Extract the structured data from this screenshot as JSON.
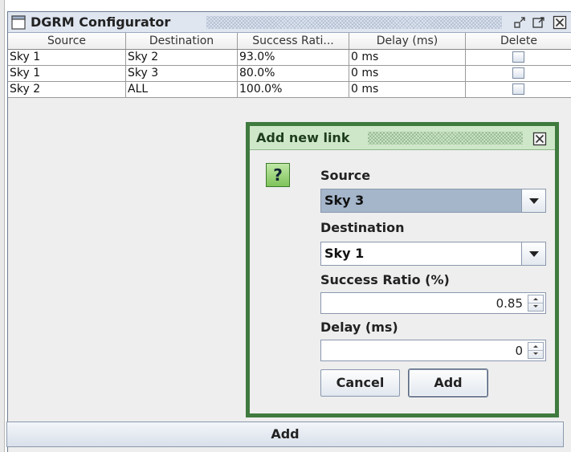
{
  "window": {
    "title": "DGRM Configurator"
  },
  "table": {
    "columns": [
      "Source",
      "Destination",
      "Success Rati...",
      "Delay (ms)",
      "Delete"
    ],
    "rows": [
      {
        "source": "Sky 1",
        "destination": "Sky 2",
        "success_ratio": "93.0%",
        "delay": "0 ms",
        "delete": false
      },
      {
        "source": "Sky 1",
        "destination": "Sky 3",
        "success_ratio": "80.0%",
        "delay": "0 ms",
        "delete": false
      },
      {
        "source": "Sky 2",
        "destination": "ALL",
        "success_ratio": "100.0%",
        "delay": "0 ms",
        "delete": false
      }
    ]
  },
  "bottom_button": {
    "label": "Add"
  },
  "dialog": {
    "title": "Add new link",
    "icon": "question-icon",
    "icon_glyph": "?",
    "source_label": "Source",
    "source_value": "Sky 3",
    "destination_label": "Destination",
    "destination_value": "Sky 1",
    "success_label": "Success Ratio (%)",
    "success_value": "0.85",
    "delay_label": "Delay (ms)",
    "delay_value": "0",
    "cancel_label": "Cancel",
    "add_label": "Add"
  },
  "colors": {
    "dialog_border": "#3f7a3f",
    "dialog_title_bg": "#cfe7c9",
    "combo_selected_bg": "#a5b6cb",
    "titlebar_bg": "#dfe6f0"
  }
}
